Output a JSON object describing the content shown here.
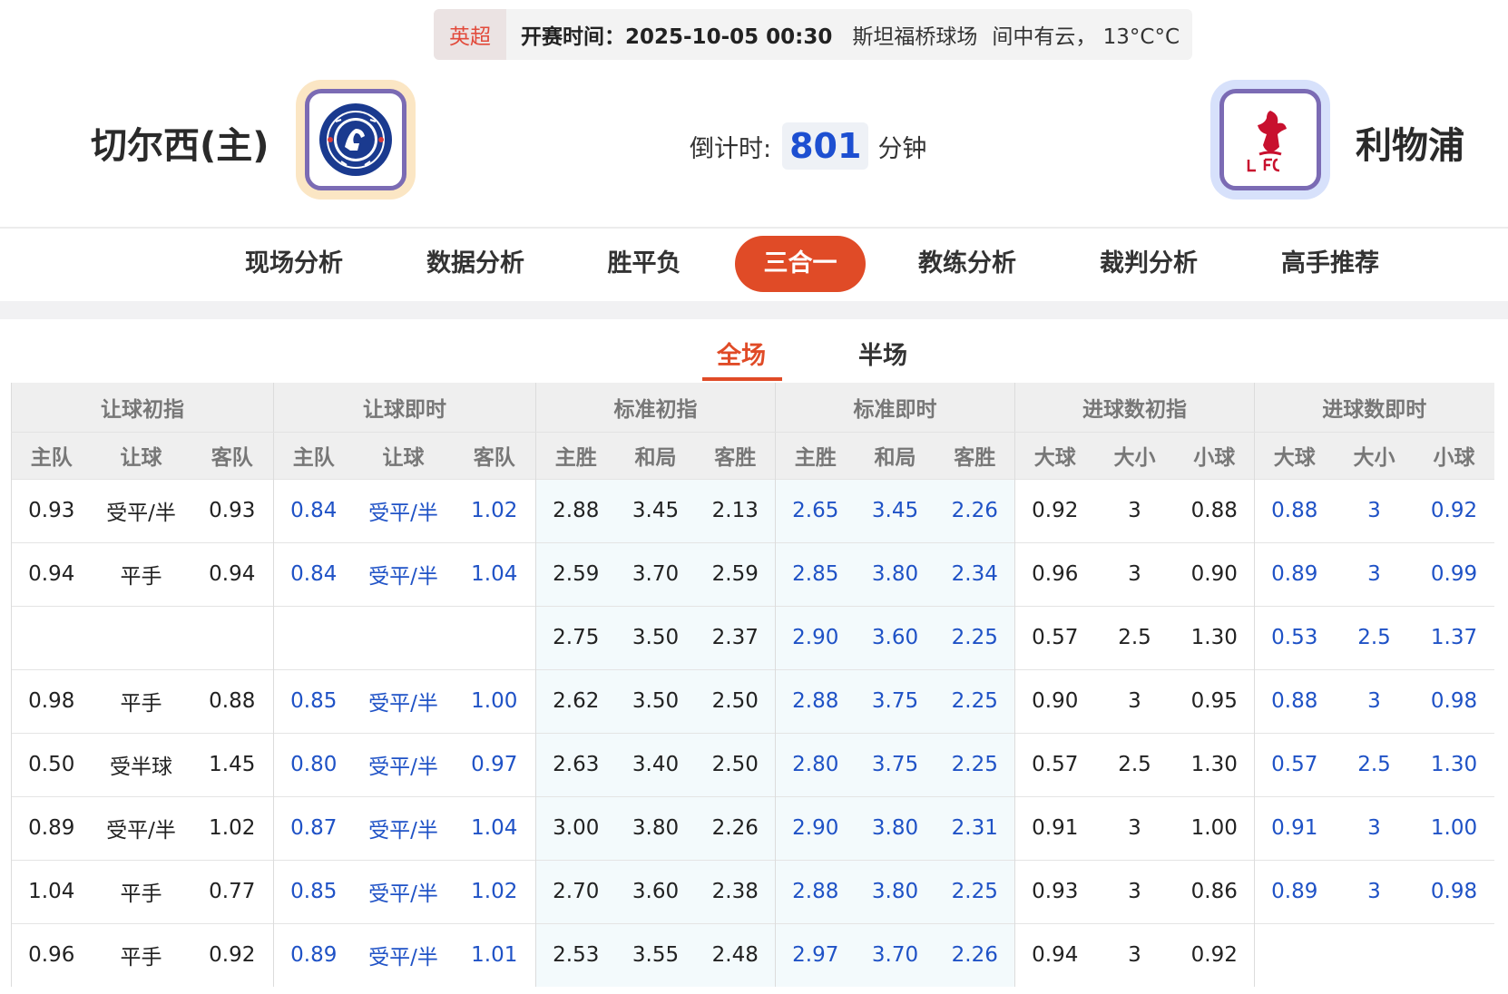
{
  "match": {
    "league": "英超",
    "kickoff_label": "开赛时间：",
    "kickoff_time": "2025-10-05 00:30",
    "venue": "斯坦福桥球场",
    "weather": "间中有云，  13°C°C"
  },
  "home": {
    "name": "切尔西(主)",
    "badge_icon": "chelsea-crest-icon"
  },
  "away": {
    "name": "利物浦",
    "badge_icon": "liverpool-crest-icon"
  },
  "countdown": {
    "label": "倒计时:",
    "value": "801",
    "unit": "分钟"
  },
  "nav": {
    "tabs": [
      "现场分析",
      "数据分析",
      "胜平负",
      "三合一",
      "教练分析",
      "裁判分析",
      "高手推荐"
    ],
    "active": "三合一"
  },
  "subtabs": {
    "items": [
      "全场",
      "半场"
    ],
    "active": "全场"
  },
  "table": {
    "groups": [
      "让球初指",
      "让球即时",
      "标准初指",
      "标准即时",
      "进球数初指",
      "进球数即时"
    ],
    "subheaders": [
      "主队",
      "让球",
      "客队",
      "主队",
      "让球",
      "客队",
      "主胜",
      "和局",
      "客胜",
      "主胜",
      "和局",
      "客胜",
      "大球",
      "大小",
      "小球",
      "大球",
      "大小",
      "小球"
    ],
    "rows": [
      [
        "0.93",
        "受平/半",
        "0.93",
        "0.84",
        "受平/半",
        "1.02",
        "2.88",
        "3.45",
        "2.13",
        "2.65",
        "3.45",
        "2.26",
        "0.92",
        "3",
        "0.88",
        "0.88",
        "3",
        "0.92"
      ],
      [
        "0.94",
        "平手",
        "0.94",
        "0.84",
        "受平/半",
        "1.04",
        "2.59",
        "3.70",
        "2.59",
        "2.85",
        "3.80",
        "2.34",
        "0.96",
        "3",
        "0.90",
        "0.89",
        "3",
        "0.99"
      ],
      [
        "",
        "",
        "",
        "",
        "",
        "",
        "2.75",
        "3.50",
        "2.37",
        "2.90",
        "3.60",
        "2.25",
        "0.57",
        "2.5",
        "1.30",
        "0.53",
        "2.5",
        "1.37"
      ],
      [
        "0.98",
        "平手",
        "0.88",
        "0.85",
        "受平/半",
        "1.00",
        "2.62",
        "3.50",
        "2.50",
        "2.88",
        "3.75",
        "2.25",
        "0.90",
        "3",
        "0.95",
        "0.88",
        "3",
        "0.98"
      ],
      [
        "0.50",
        "受半球",
        "1.45",
        "0.80",
        "受平/半",
        "0.97",
        "2.63",
        "3.40",
        "2.50",
        "2.80",
        "3.75",
        "2.25",
        "0.57",
        "2.5",
        "1.30",
        "0.57",
        "2.5",
        "1.30"
      ],
      [
        "0.89",
        "受平/半",
        "1.02",
        "0.87",
        "受平/半",
        "1.04",
        "3.00",
        "3.80",
        "2.26",
        "2.90",
        "3.80",
        "2.31",
        "0.91",
        "3",
        "1.00",
        "0.91",
        "3",
        "1.00"
      ],
      [
        "1.04",
        "平手",
        "0.77",
        "0.85",
        "受平/半",
        "1.02",
        "2.70",
        "3.60",
        "2.38",
        "2.88",
        "3.80",
        "2.25",
        "0.93",
        "3",
        "0.86",
        "0.89",
        "3",
        "0.98"
      ],
      [
        "0.96",
        "平手",
        "0.92",
        "0.89",
        "受平/半",
        "1.01",
        "2.53",
        "3.55",
        "2.48",
        "2.97",
        "3.70",
        "2.26",
        "0.94",
        "3",
        "0.92",
        "",
        "",
        ""
      ]
    ]
  },
  "colors": {
    "accent": "#e04b27",
    "live_value": "#1f52c6",
    "league": "#e24a3b"
  }
}
